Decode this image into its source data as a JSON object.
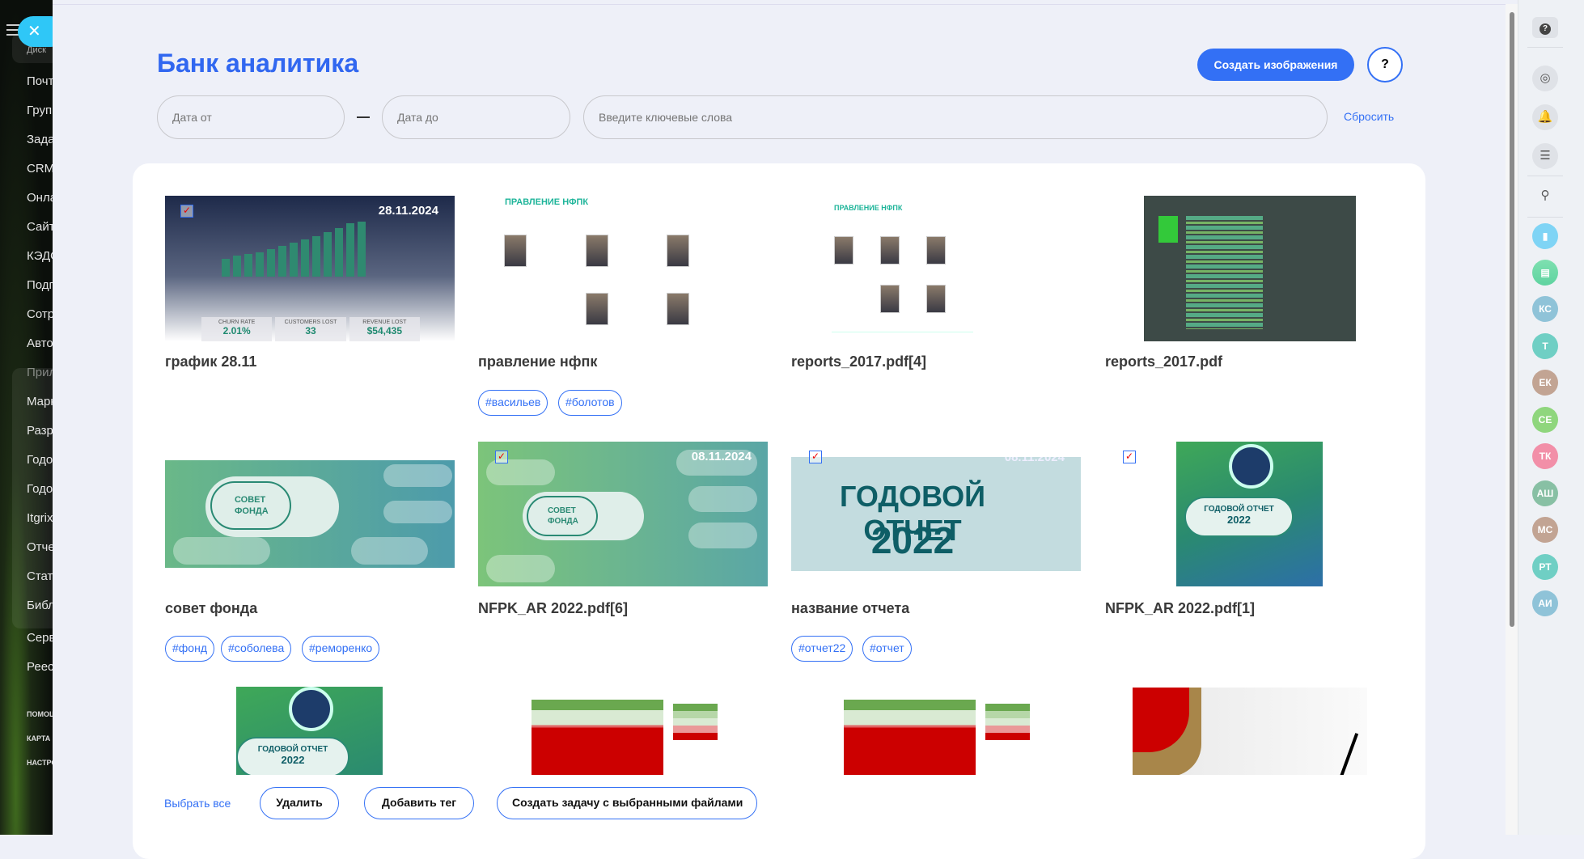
{
  "sidebar": {
    "items": [
      "Диск",
      "Почта",
      "Группы",
      "Задачи",
      "CRM",
      "Онлайн",
      "Сайты",
      "КЭДО",
      "Подпись",
      "Сотрудники",
      "Автоматизация",
      "Приложения",
      "Маркет",
      "Разработчикам",
      "Годовой",
      "Годовой",
      "Itgrix",
      "Отчеты",
      "Статистика",
      "Библиотека",
      "Сервисы",
      "Реестр"
    ],
    "footer": [
      "ПОМОЩЬ",
      "КАРТА",
      "НАСТРОЙКИ"
    ]
  },
  "header": {
    "title": "Банк аналитика",
    "create_label": "Создать изображения",
    "help_label": "?"
  },
  "filters": {
    "date_from_placeholder": "Дата от",
    "date_to_placeholder": "Дата до",
    "keywords_placeholder": "Введите ключевые слова",
    "reset_label": "Сбросить"
  },
  "items": [
    {
      "caption": "график 28.11",
      "tags": [],
      "date": "28.11.2024",
      "checked": true,
      "stats": {
        "labels": [
          "CHURN RATE",
          "CUSTOMERS LOST",
          "REVENUE LOST"
        ],
        "values": [
          "2.01%",
          "33",
          "$54,435"
        ]
      }
    },
    {
      "caption": "правление нфпк",
      "tags": [
        "#васильев",
        "#болотов"
      ],
      "slide_title": "ПРАВЛЕНИЕ НФПК"
    },
    {
      "caption": "reports_2017.pdf[4]",
      "tags": [],
      "slide_title": "ПРАВЛЕНИЕ НФПК"
    },
    {
      "caption": "reports_2017.pdf",
      "tags": []
    },
    {
      "caption": "совет фонда",
      "tags": [
        "#фонд",
        "#соболева",
        "#реморенко"
      ],
      "badge": "СОВЕТ ФОНДА"
    },
    {
      "caption": "NFPK_AR 2022.pdf[6]",
      "tags": [],
      "date": "08.11.2024",
      "checked": true,
      "badge": "СОВЕТ ФОНДА"
    },
    {
      "caption": "название отчета",
      "tags": [
        "#отчет22",
        "#отчет"
      ],
      "date": "08.11.2024",
      "checked": true,
      "cover_title": "ГОДОВОЙ ОТЧЕТ",
      "cover_year": "2022"
    },
    {
      "caption": "NFPK_AR 2022.pdf[1]",
      "tags": [],
      "checked": true,
      "cover_title": "ГОДОВОЙ ОТЧЕТ",
      "cover_year": "2022"
    },
    {
      "cover_title": "ГОДОВОЙ ОТЧЕТ",
      "cover_year": "2022"
    },
    {},
    {},
    {}
  ],
  "actions": {
    "select_all": "Выбрать все",
    "delete": "Удалить",
    "add_tag": "Добавить тег",
    "create_task": "Создать задачу с выбранными файлами"
  },
  "right_panel": {
    "icons": [
      "help-icon",
      "copilot-icon",
      "bell-icon",
      "chat-icon",
      "search-icon",
      "bookmark-icon",
      "news-icon"
    ],
    "avatars": [
      {
        "initials": "КС",
        "color": "#8fc3d8"
      },
      {
        "initials": "Т",
        "color": "#6fcfc4"
      },
      {
        "initials": "ЕК",
        "color": "#c2a493"
      },
      {
        "initials": "СЕ",
        "color": "#8fd67d"
      },
      {
        "initials": "ТК",
        "color": "#f28fa8"
      },
      {
        "initials": "АШ",
        "color": "#88c0a4"
      },
      {
        "initials": "МС",
        "color": "#c2a493"
      },
      {
        "initials": "РТ",
        "color": "#6fcfc4"
      },
      {
        "initials": "АИ",
        "color": "#8fc3d8"
      }
    ]
  },
  "colors": {
    "accent": "#3370f5",
    "title": "#3167f0",
    "background": "#eef0f8"
  }
}
